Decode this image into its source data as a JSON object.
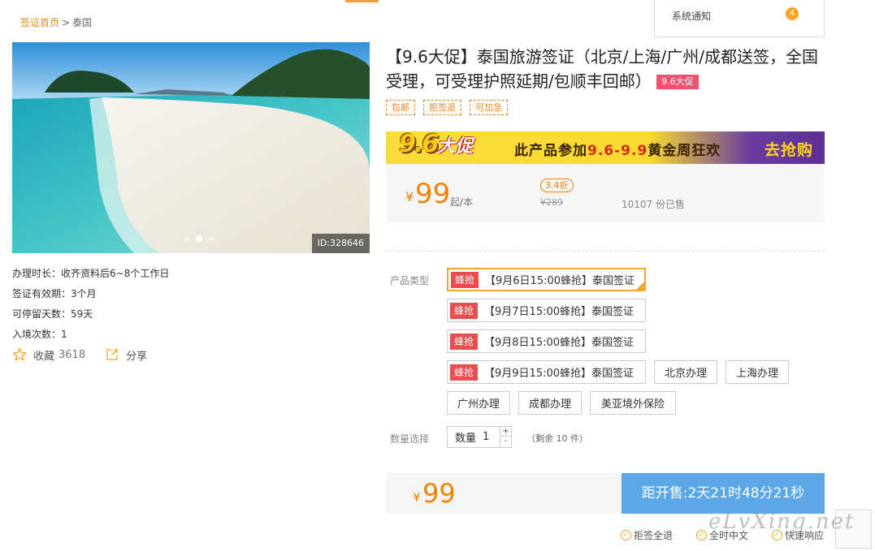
{
  "notice": {
    "label": "系统通知",
    "count": "4"
  },
  "breadcrumb": {
    "home": "签证首页",
    "sep": ">",
    "current": "泰国"
  },
  "photo": {
    "id_label": "ID:328646"
  },
  "details": [
    "办理时长：收齐资料后6~8个工作日",
    "签证有效期：3个月",
    "可停留天数：59天",
    "入境次数：1"
  ],
  "actions": {
    "favorite_label": "收藏",
    "favorite_count": "3618",
    "share_label": "分享"
  },
  "product": {
    "title": "【9.6大促】泰国旅游签证（北京/上海/广州/成都送签，全国受理，可受理护照延期/包顺丰回邮）",
    "promo_tag": "9.6大促",
    "tags": [
      "包邮",
      "拒签退",
      "可加急"
    ]
  },
  "banner": {
    "logo_main": "9.6",
    "logo_sub": "大促",
    "text_prefix": "此产品参加",
    "text_highlight": "9.6-9.9",
    "text_suffix": "黄金周狂欢",
    "cta": "去抢购"
  },
  "price": {
    "currency": "¥",
    "amount": "99",
    "unit": "起/本",
    "discount": "3.4折",
    "original": "¥289",
    "sold": "10107 份已售"
  },
  "options": {
    "type_label": "产品类型",
    "snap_badge": "蜂抢",
    "items": [
      "【9月6日15:00蜂抢】泰国签证",
      "【9月7日15:00蜂抢】泰国签证",
      "【9月8日15:00蜂抢】泰国签证",
      "【9月9日15:00蜂抢】泰国签证",
      "北京办理",
      "上海办理",
      "广州办理",
      "成都办理",
      "美亚境外保险"
    ]
  },
  "quantity": {
    "section_label": "数量选择",
    "label": "数量",
    "value": "1",
    "plus": "+",
    "minus": "-",
    "remaining": "（剩余 10 件）"
  },
  "buy": {
    "currency": "¥",
    "amount": "99",
    "countdown": "距开售:2天21时48分21秒"
  },
  "guarantees": [
    "拒签全退",
    "全时中文",
    "快速响应"
  ],
  "watermark": "eLvXing.net"
}
